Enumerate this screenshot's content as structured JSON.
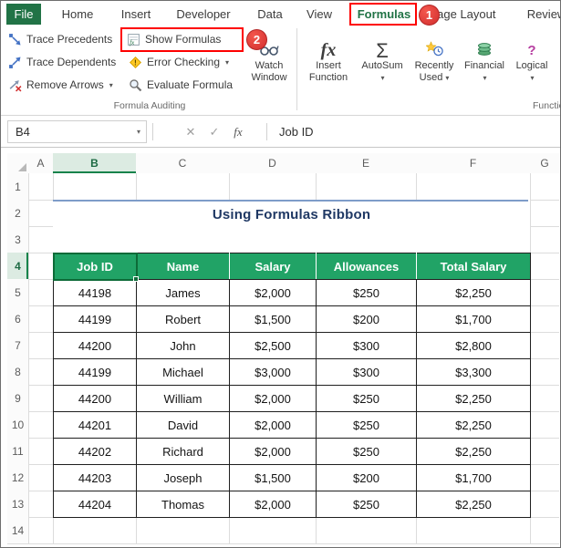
{
  "colors": {
    "excel_green": "#217346",
    "table_header_green": "#21a366",
    "selection_green": "#0d6b38",
    "annotation_red": "#fe0000",
    "title_blue": "#1f3864",
    "title_line_blue": "#7e9cc9"
  },
  "tabs": {
    "items": [
      {
        "label": "File"
      },
      {
        "label": "Home"
      },
      {
        "label": "Insert"
      },
      {
        "label": "Developer"
      },
      {
        "label": "Data"
      },
      {
        "label": "View"
      },
      {
        "label": "Formulas"
      },
      {
        "label": "Page Layout"
      },
      {
        "label": "Review"
      }
    ]
  },
  "annotations": {
    "step1": "1",
    "step2": "2"
  },
  "ribbon": {
    "formula_auditing": {
      "trace_precedents": "Trace Precedents",
      "trace_dependents": "Trace Dependents",
      "remove_arrows": "Remove Arrows",
      "show_formulas": "Show Formulas",
      "error_checking": "Error Checking",
      "evaluate_formula": "Evaluate Formula",
      "watch_line1": "Watch",
      "watch_line2": "Window",
      "group_label": "Formula Auditing"
    },
    "function_library": {
      "insert_line1": "Insert",
      "insert_line2": "Function",
      "autosum": "AutoSum",
      "recently_line1": "Recently",
      "recently_line2": "Used",
      "financial": "Financial",
      "logical": "Logical",
      "group_label": "Function Library"
    }
  },
  "icons": {
    "chevron_down": "▾",
    "cancel": "✕",
    "enter": "✓",
    "fx": "fx",
    "sigma": "Σ",
    "question": "?"
  },
  "formula_bar": {
    "name_box": "B4",
    "content": "Job ID"
  },
  "sheet": {
    "columns": [
      "A",
      "B",
      "C",
      "D",
      "E",
      "F",
      "G"
    ],
    "rows": [
      "1",
      "2",
      "3",
      "4",
      "5",
      "6",
      "7",
      "8",
      "9",
      "10",
      "11",
      "12",
      "13",
      "14"
    ],
    "selected_column": "B",
    "selected_row": "4",
    "title": "Using Formulas Ribbon"
  },
  "table": {
    "headers": [
      "Job ID",
      "Name",
      "Salary",
      "Allowances",
      "Total Salary"
    ],
    "rows": [
      [
        "44198",
        "James",
        "$2,000",
        "$250",
        "$2,250"
      ],
      [
        "44199",
        "Robert",
        "$1,500",
        "$200",
        "$1,700"
      ],
      [
        "44200",
        "John",
        "$2,500",
        "$300",
        "$2,800"
      ],
      [
        "44199",
        "Michael",
        "$3,000",
        "$300",
        "$3,300"
      ],
      [
        "44200",
        "William",
        "$2,000",
        "$250",
        "$2,250"
      ],
      [
        "44201",
        "David",
        "$2,000",
        "$250",
        "$2,250"
      ],
      [
        "44202",
        "Richard",
        "$2,000",
        "$250",
        "$2,250"
      ],
      [
        "44203",
        "Joseph",
        "$1,500",
        "$200",
        "$1,700"
      ],
      [
        "44204",
        "Thomas",
        "$2,000",
        "$250",
        "$2,250"
      ]
    ]
  }
}
